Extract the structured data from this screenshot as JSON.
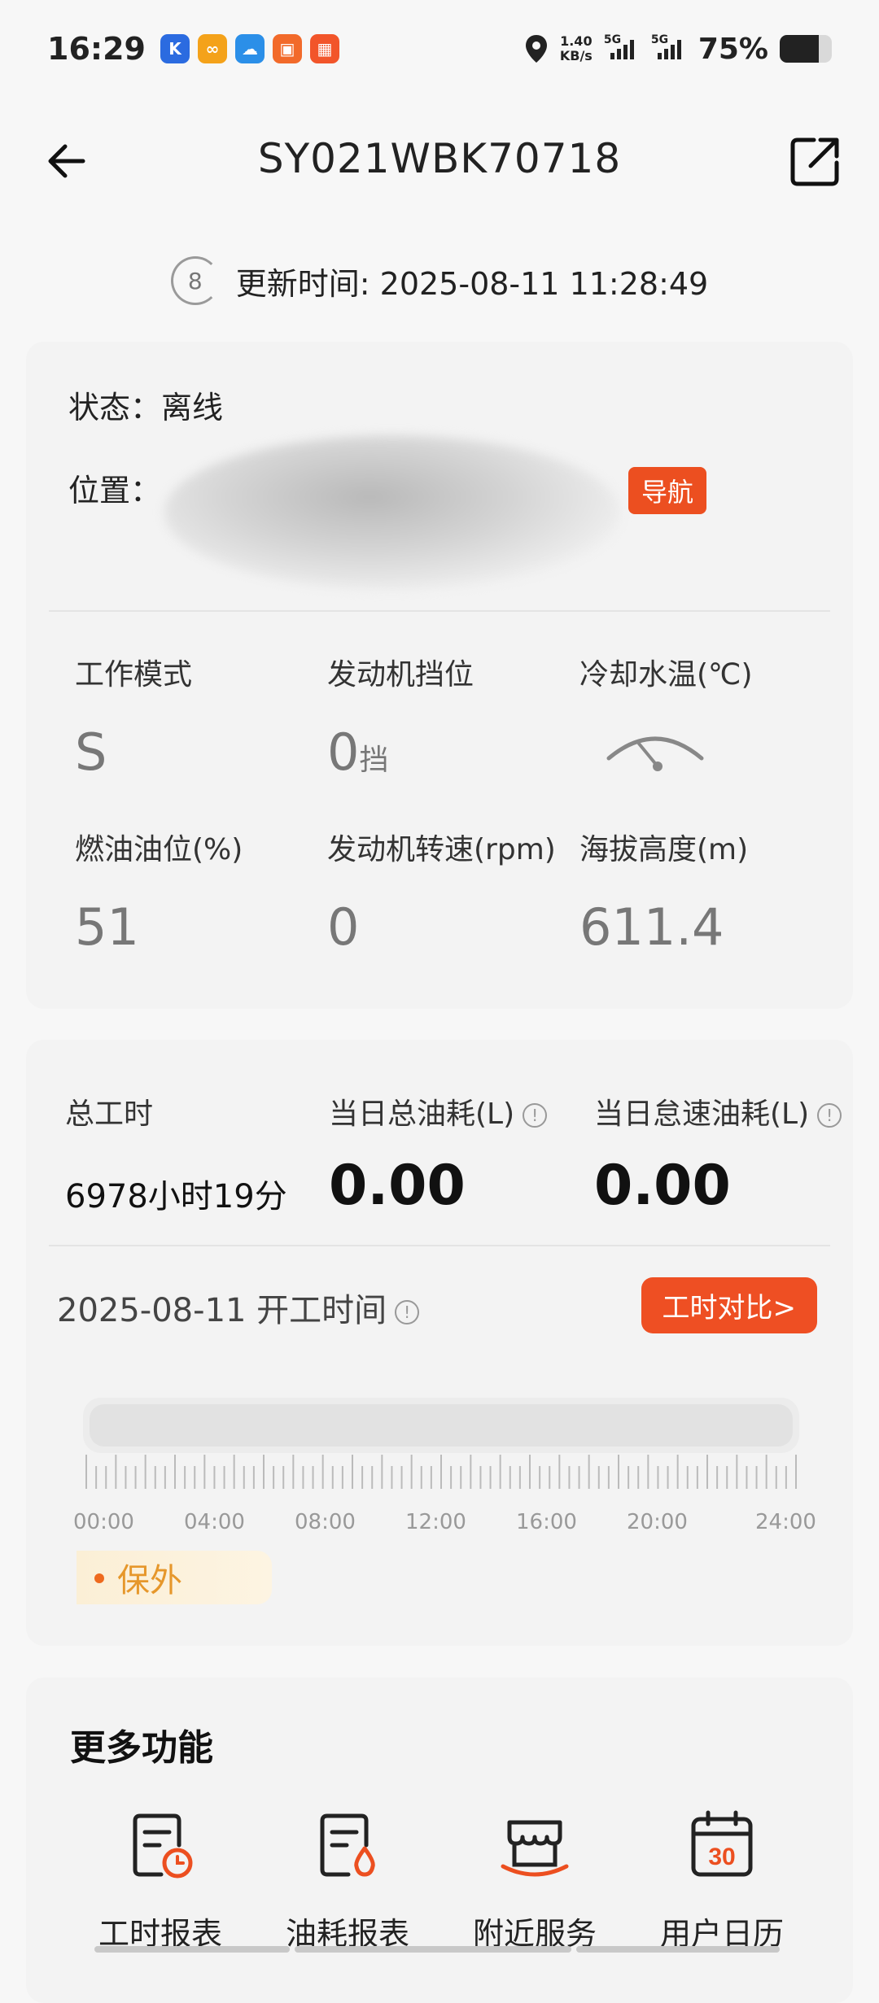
{
  "status_bar": {
    "time": "16:29",
    "net_speed_value": "1.40",
    "net_speed_unit": "KB/s",
    "sim1_label": "5G",
    "sim2_label": "5G",
    "battery_pct": "75%",
    "battery_level": 0.75,
    "app_icons": [
      {
        "name": "k-app-icon",
        "glyph": "K",
        "color": "#2b6be0"
      },
      {
        "name": "link-app-icon",
        "glyph": "∞",
        "color": "#f4a21a"
      },
      {
        "name": "cloud-app-icon",
        "glyph": "☁",
        "color": "#2b8fe8"
      },
      {
        "name": "shop-app-icon",
        "glyph": "▣",
        "color": "#f26a2a"
      },
      {
        "name": "grid-app-icon",
        "glyph": "▦",
        "color": "#f2552a"
      }
    ]
  },
  "header": {
    "title": "SY021WBK70718"
  },
  "update": {
    "countdown": "8",
    "label": "更新时间: 2025-08-11 11:28:49"
  },
  "basic": {
    "status_label": "状态：",
    "status_value": "离线",
    "location_label": "位置：",
    "nav_button": "导航"
  },
  "metrics": {
    "work_mode_label": "工作模式",
    "work_mode_value": "S",
    "gear_label": "发动机挡位",
    "gear_value": "0",
    "gear_unit": "挡",
    "coolant_label": "冷却水温(℃)",
    "fuel_label": "燃油油位(%)",
    "fuel_value": "51",
    "rpm_label": "发动机转速(rpm)",
    "rpm_value": "0",
    "altitude_label": "海拔高度(m)",
    "altitude_value": "611.4"
  },
  "usage": {
    "total_hours_label": "总工时",
    "total_hours_value": "6978小时19分",
    "daily_fuel_label": "当日总油耗(L)",
    "daily_fuel_value": "0.00",
    "idle_fuel_label": "当日怠速油耗(L)",
    "idle_fuel_value": "0.00",
    "day_title": "2025-08-11 开工时间",
    "compare_button": "工时对比>",
    "hour_labels": [
      "00:00",
      "04:00",
      "08:00",
      "12:00",
      "16:00",
      "20:00",
      "24:00"
    ],
    "warranty": "保外"
  },
  "more": {
    "title": "更多功能",
    "items": [
      {
        "label": "工时报表"
      },
      {
        "label": "油耗报表"
      },
      {
        "label": "附近服务"
      },
      {
        "label": "用户日历",
        "day": "30"
      }
    ]
  },
  "colors": {
    "accent": "#ec4f20",
    "warranty_text": "#e6972b"
  }
}
